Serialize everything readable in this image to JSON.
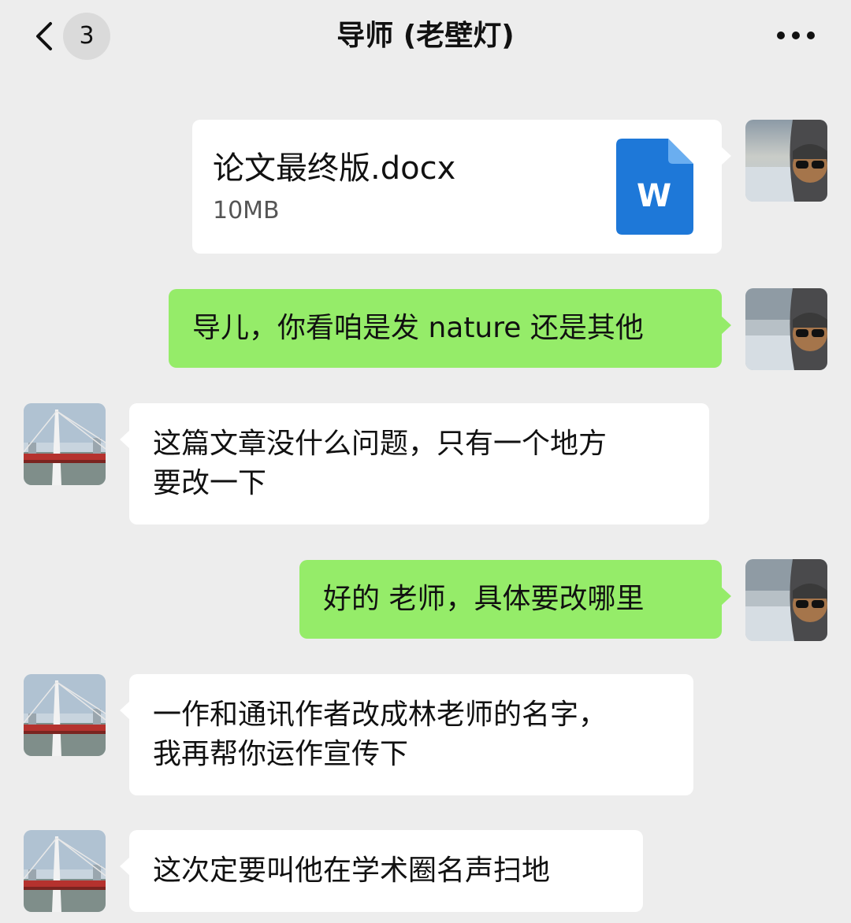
{
  "header": {
    "unread_count": "3",
    "title": "导师 (老壁灯)"
  },
  "messages": [
    {
      "sender": "me",
      "type": "file",
      "file_name": "论文最终版.docx",
      "file_size": "10MB",
      "file_icon_letter": "W"
    },
    {
      "sender": "me",
      "type": "text",
      "text": "导儿，你看咱是发 nature 还是其他"
    },
    {
      "sender": "contact",
      "type": "text",
      "text": "这篇文章没什么问题，只有一个地方\n要改一下"
    },
    {
      "sender": "me",
      "type": "text",
      "text": "好的 老师，具体要改哪里"
    },
    {
      "sender": "contact",
      "type": "text",
      "text": "一作和通讯作者改成林老师的名字，\n我再帮你运作宣传下"
    },
    {
      "sender": "contact",
      "type": "text",
      "text": "这次定要叫他在学术圈名声扫地"
    }
  ],
  "colors": {
    "background": "#ededed",
    "outgoing_bubble": "#95ec69",
    "incoming_bubble": "#ffffff",
    "word_icon": "#1e78d8"
  }
}
